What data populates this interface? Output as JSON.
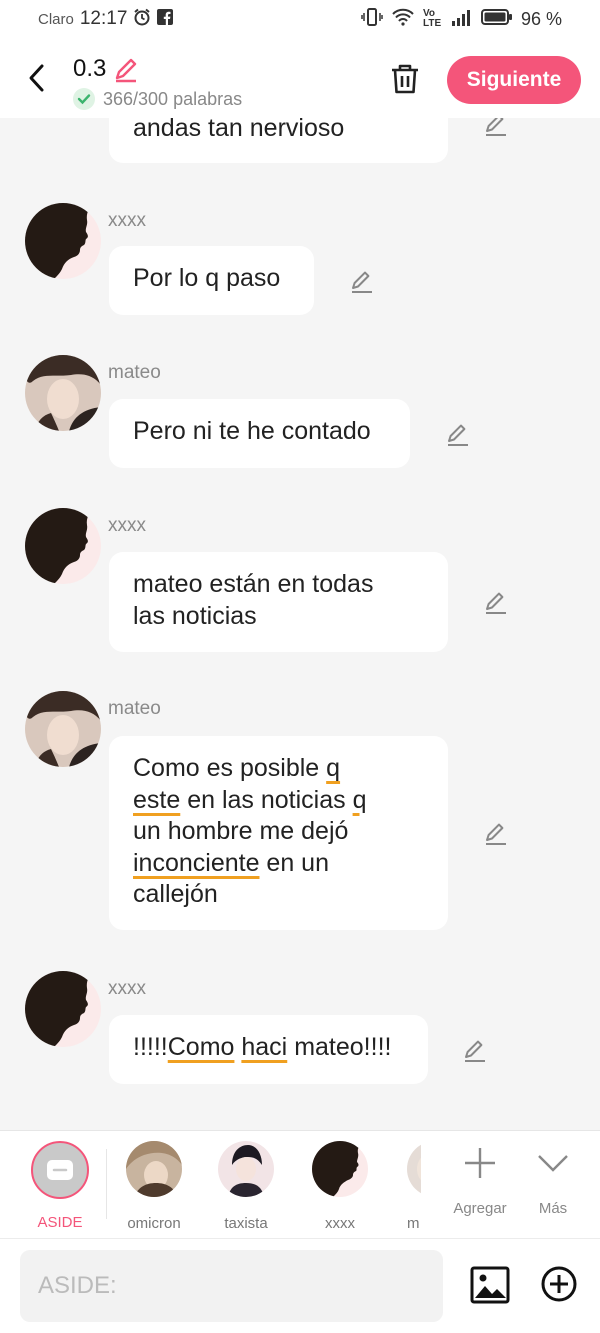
{
  "status_bar": {
    "carrier": "Claro",
    "time": "12:17",
    "network": "Vo LTE",
    "battery": "96 %"
  },
  "header": {
    "version": "0.3",
    "word_count": "366/300 palabras",
    "next_label": "Siguiente"
  },
  "messages": [
    {
      "sender": "",
      "avatar": "silhouette",
      "text": "andas tan nervioso"
    },
    {
      "sender": "xxxx",
      "avatar": "silhouette",
      "text": "Por lo q paso"
    },
    {
      "sender": "mateo",
      "avatar": "photo",
      "text": "Pero ni te he contado"
    },
    {
      "sender": "xxxx",
      "avatar": "silhouette",
      "text_lines": [
        "mateo están en todas",
        "las noticias"
      ]
    },
    {
      "sender": "mateo",
      "avatar": "photo",
      "text_lines": [
        "Como es posible q",
        "este en las noticias q",
        "un hombre me dejó",
        "inconciente en un",
        "callejón"
      ]
    },
    {
      "sender": "xxxx",
      "avatar": "silhouette",
      "text": "!!!!!Como haci mateo!!!!"
    }
  ],
  "characters": [
    {
      "label": "ASIDE",
      "selected": true
    },
    {
      "label": "omicron"
    },
    {
      "label": "taxista"
    },
    {
      "label": "xxxx"
    },
    {
      "label": "m"
    }
  ],
  "tools": {
    "add_label": "Agregar",
    "more_label": "Más"
  },
  "input": {
    "placeholder": "ASIDE:"
  },
  "colors": {
    "accent": "#f4557a",
    "underline": "#f0a020",
    "check": "#3cb46e"
  }
}
